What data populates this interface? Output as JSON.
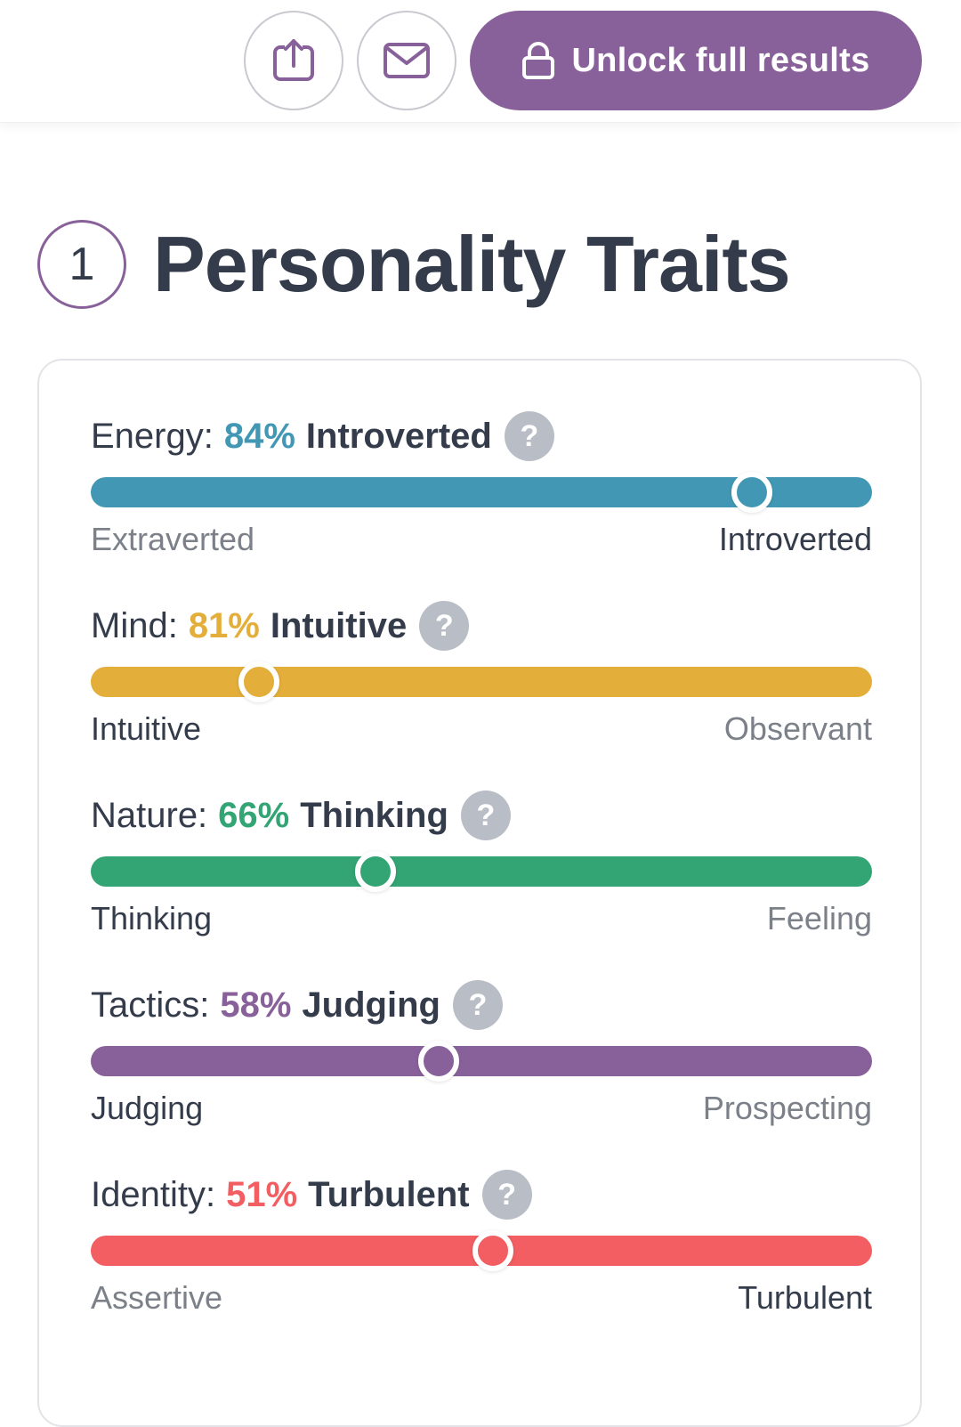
{
  "header": {
    "share_icon": "share-upload-icon",
    "mail_icon": "envelope-icon",
    "unlock_label": "Unlock full results",
    "lock_icon": "lock-icon"
  },
  "section": {
    "number": "1",
    "title": "Personality Traits"
  },
  "traits": [
    {
      "label": "Energy:",
      "percent": "84%",
      "result": "Introverted",
      "color": "#4298b4",
      "position": 0.846,
      "left_label": "Extraverted",
      "right_label": "Introverted",
      "highlight": "right"
    },
    {
      "label": "Mind:",
      "percent": "81%",
      "result": "Intuitive",
      "color": "#e4ae3a",
      "position": 0.215,
      "left_label": "Intuitive",
      "right_label": "Observant",
      "highlight": "left"
    },
    {
      "label": "Nature:",
      "percent": "66%",
      "result": "Thinking",
      "color": "#33a474",
      "position": 0.365,
      "left_label": "Thinking",
      "right_label": "Feeling",
      "highlight": "left"
    },
    {
      "label": "Tactics:",
      "percent": "58%",
      "result": "Judging",
      "color": "#88619a",
      "position": 0.445,
      "left_label": "Judging",
      "right_label": "Prospecting",
      "highlight": "left"
    },
    {
      "label": "Identity:",
      "percent": "51%",
      "result": "Turbulent",
      "color": "#f25e62",
      "position": 0.515,
      "left_label": "Assertive",
      "right_label": "Turbulent",
      "highlight": "right"
    }
  ],
  "help_glyph": "?"
}
